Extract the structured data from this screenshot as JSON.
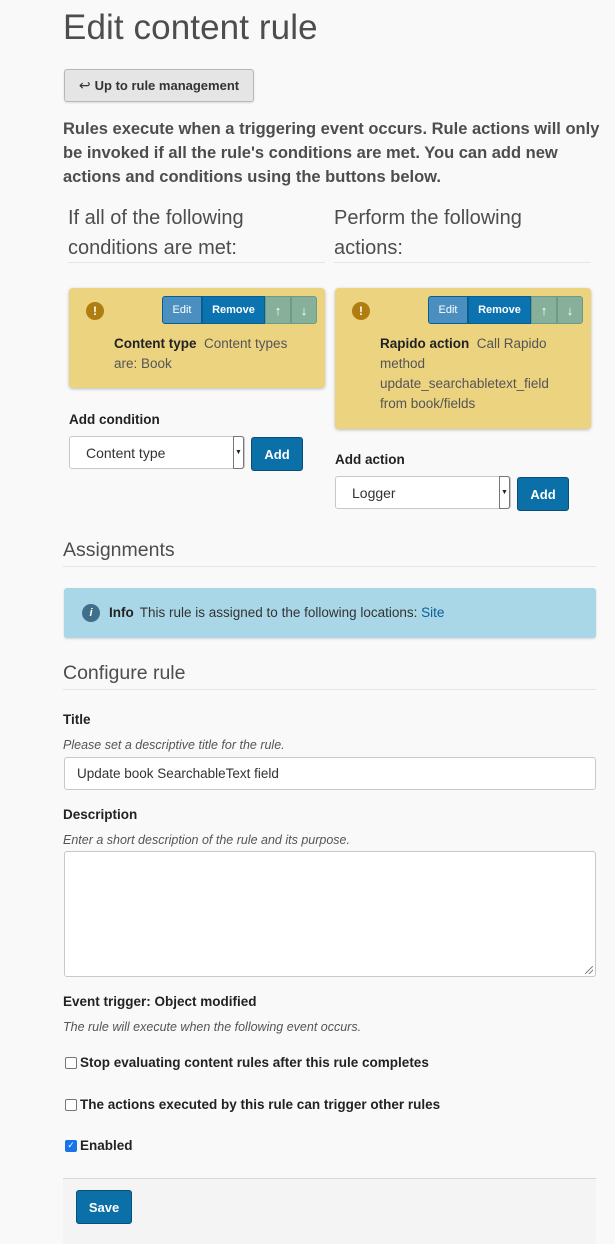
{
  "page": {
    "title": "Edit content rule",
    "up_button_icon": "return-arrow-icon",
    "up_button_label": "Up to rule management",
    "intro": "Rules execute when a triggering event occurs. Rule actions will only be invoked if all the rule's conditions are met. You can add new actions and conditions using the buttons below."
  },
  "conditions": {
    "heading": "If all of the following conditions are met:",
    "items": [
      {
        "name": "Content type",
        "summary": "Content types are: Book",
        "edit_label": "Edit",
        "remove_label": "Remove",
        "up_label": "↑",
        "down_label": "↓"
      }
    ],
    "add_label": "Add condition",
    "select_value": "Content type",
    "add_button": "Add"
  },
  "actions": {
    "heading": "Perform the following actions:",
    "items": [
      {
        "name": "Rapido action",
        "summary": "Call Rapido method update_searchabletext_field from book/fields",
        "edit_label": "Edit",
        "remove_label": "Remove",
        "up_label": "↑",
        "down_label": "↓"
      }
    ],
    "add_label": "Add action",
    "select_value": "Logger",
    "add_button": "Add"
  },
  "assignments": {
    "heading": "Assignments",
    "info_label": "Info",
    "info_text": "This rule is assigned to the following locations:",
    "info_link": "Site"
  },
  "configure": {
    "heading": "Configure rule",
    "title_label": "Title",
    "title_help": "Please set a descriptive title for the rule.",
    "title_value": "Update book SearchableText field",
    "description_label": "Description",
    "description_help": "Enter a short description of the rule and its purpose.",
    "description_value": "",
    "event_trigger": "Event trigger: Object modified",
    "event_help": "The rule will execute when the following event occurs.",
    "stop_label": "Stop evaluating content rules after this rule completes",
    "cascade_label": "The actions executed by this rule can trigger other rules",
    "enabled_label": "Enabled",
    "stop_checked": false,
    "cascade_checked": false,
    "enabled_checked": true,
    "save_label": "Save"
  },
  "colors": {
    "card_bg": "#ebd380",
    "primary": "#0b6fa8",
    "info_bg": "#a9d7e8"
  }
}
